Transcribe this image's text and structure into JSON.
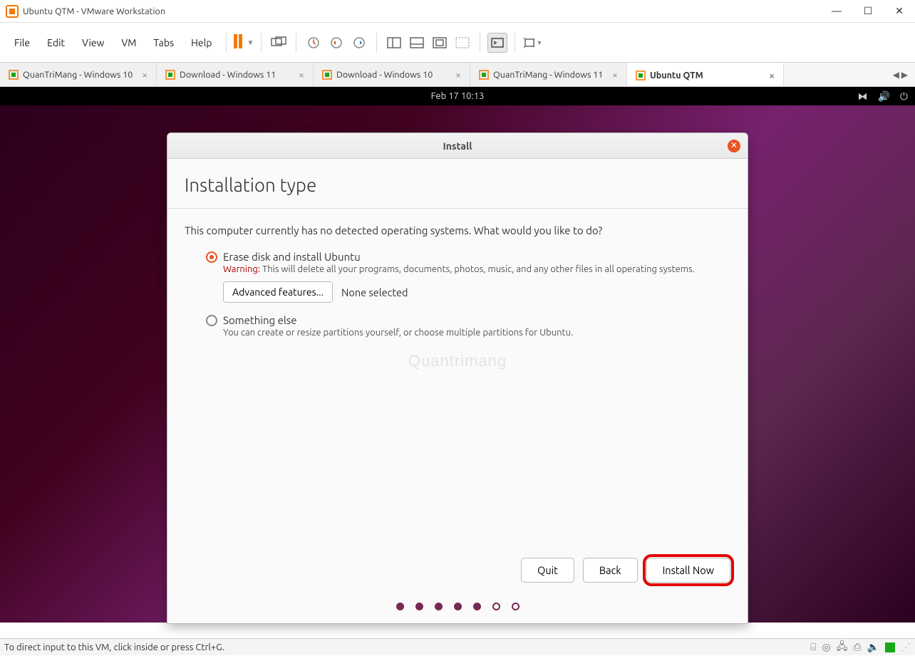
{
  "window": {
    "title": "Ubuntu QTM - VMware Workstation"
  },
  "menu": {
    "items": [
      "File",
      "Edit",
      "View",
      "VM",
      "Tabs",
      "Help"
    ]
  },
  "vm_tabs": {
    "items": [
      {
        "label": "QuanTriMang - Windows 10",
        "active": false
      },
      {
        "label": "Download - Windows 11",
        "active": false
      },
      {
        "label": "Download - Windows 10",
        "active": false
      },
      {
        "label": "QuanTriMang - Windows 11",
        "active": false
      },
      {
        "label": "Ubuntu QTM",
        "active": true
      }
    ]
  },
  "guest": {
    "clock": "Feb 17  10:13"
  },
  "installer": {
    "dialog_title": "Install",
    "heading": "Installation type",
    "prompt": "This computer currently has no detected operating systems. What would you like to do?",
    "option_erase": {
      "label": "Erase disk and install Ubuntu",
      "warning_prefix": "Warning:",
      "warning_text": " This will delete all your programs, documents, photos, music, and any other files in all operating systems.",
      "advanced_button": "Advanced features...",
      "advanced_status": "None selected"
    },
    "option_else": {
      "label": "Something else",
      "desc": "You can create or resize partitions yourself, or choose multiple partitions for Ubuntu."
    },
    "buttons": {
      "quit": "Quit",
      "back": "Back",
      "install_now": "Install Now"
    },
    "progress": {
      "total": 7,
      "filled": 5
    }
  },
  "statusbar": {
    "hint": "To direct input to this VM, click inside or press Ctrl+G."
  },
  "watermark": "Quantrimang"
}
